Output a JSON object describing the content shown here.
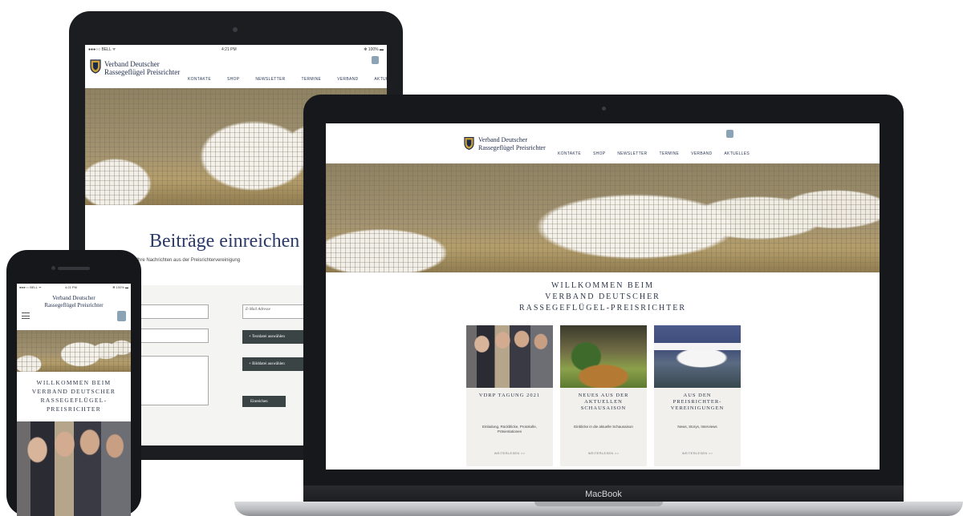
{
  "site": {
    "brand_line1": "Verband Deutscher",
    "brand_line2": "Rassegeflügel Preisrichter",
    "nav": [
      "KONTAKTE",
      "SHOP",
      "NEWSLETTER",
      "TERMINE",
      "VERBAND",
      "AKTUELLES"
    ],
    "welcome_lines": [
      "WILLKOMMEN BEIM",
      "VERBAND DEUTSCHER",
      "RASSEGEFLÜGEL-PREISRICHTER"
    ],
    "phone_welcome_lines": [
      "WILLKOMMEN BEIM",
      "VERBAND DEUTSCHER",
      "RASSEGEFLÜGEL-",
      "PREISRICHTER"
    ],
    "cards": [
      {
        "title": "VDRP TAGUNG 2021",
        "description": "Einladung, Rückblicke, Protokolle, Präsentationen",
        "more": "WEITERLESEN >>"
      },
      {
        "title": "NEUES AUS DER AKTUELLEN SCHAUSAISON",
        "description": "Einblicke in die aktuelle Schausaison",
        "more": "WEITERLESEN >>"
      },
      {
        "title": "AUS DEN PREISRICHTER-VEREINIGUNGEN",
        "description": "News, Storys, Interviews",
        "more": "WEITERLESEN >>"
      }
    ]
  },
  "tablet": {
    "status": {
      "carrier": "●●●○○ BELL ᯤ",
      "time": "4:21 PM",
      "battery": "✻ 100% ▬"
    },
    "page_title": "Beiträge einreichen",
    "subtitle": "Hier können Sie Ihre Nachrichten aus der Preisrichtervereinigung",
    "email_placeholder": "E-Mail Adresse",
    "upload_text_button": "+ Textdatei auswählen",
    "upload_image_button": "+ Bilddatei auswählen",
    "submit_button": "Einreichen"
  },
  "phone": {
    "status": {
      "carrier": "●●●○○ BELL ᯤ",
      "time": "4:21 PM",
      "battery": "✻ 100% ▬"
    }
  },
  "laptop": {
    "label": "MacBook"
  },
  "colors": {
    "navy": "#2b3448",
    "card_bg": "#f1f0ec",
    "button_dark": "#3b4445",
    "cart_blue": "#8aa3b5"
  }
}
